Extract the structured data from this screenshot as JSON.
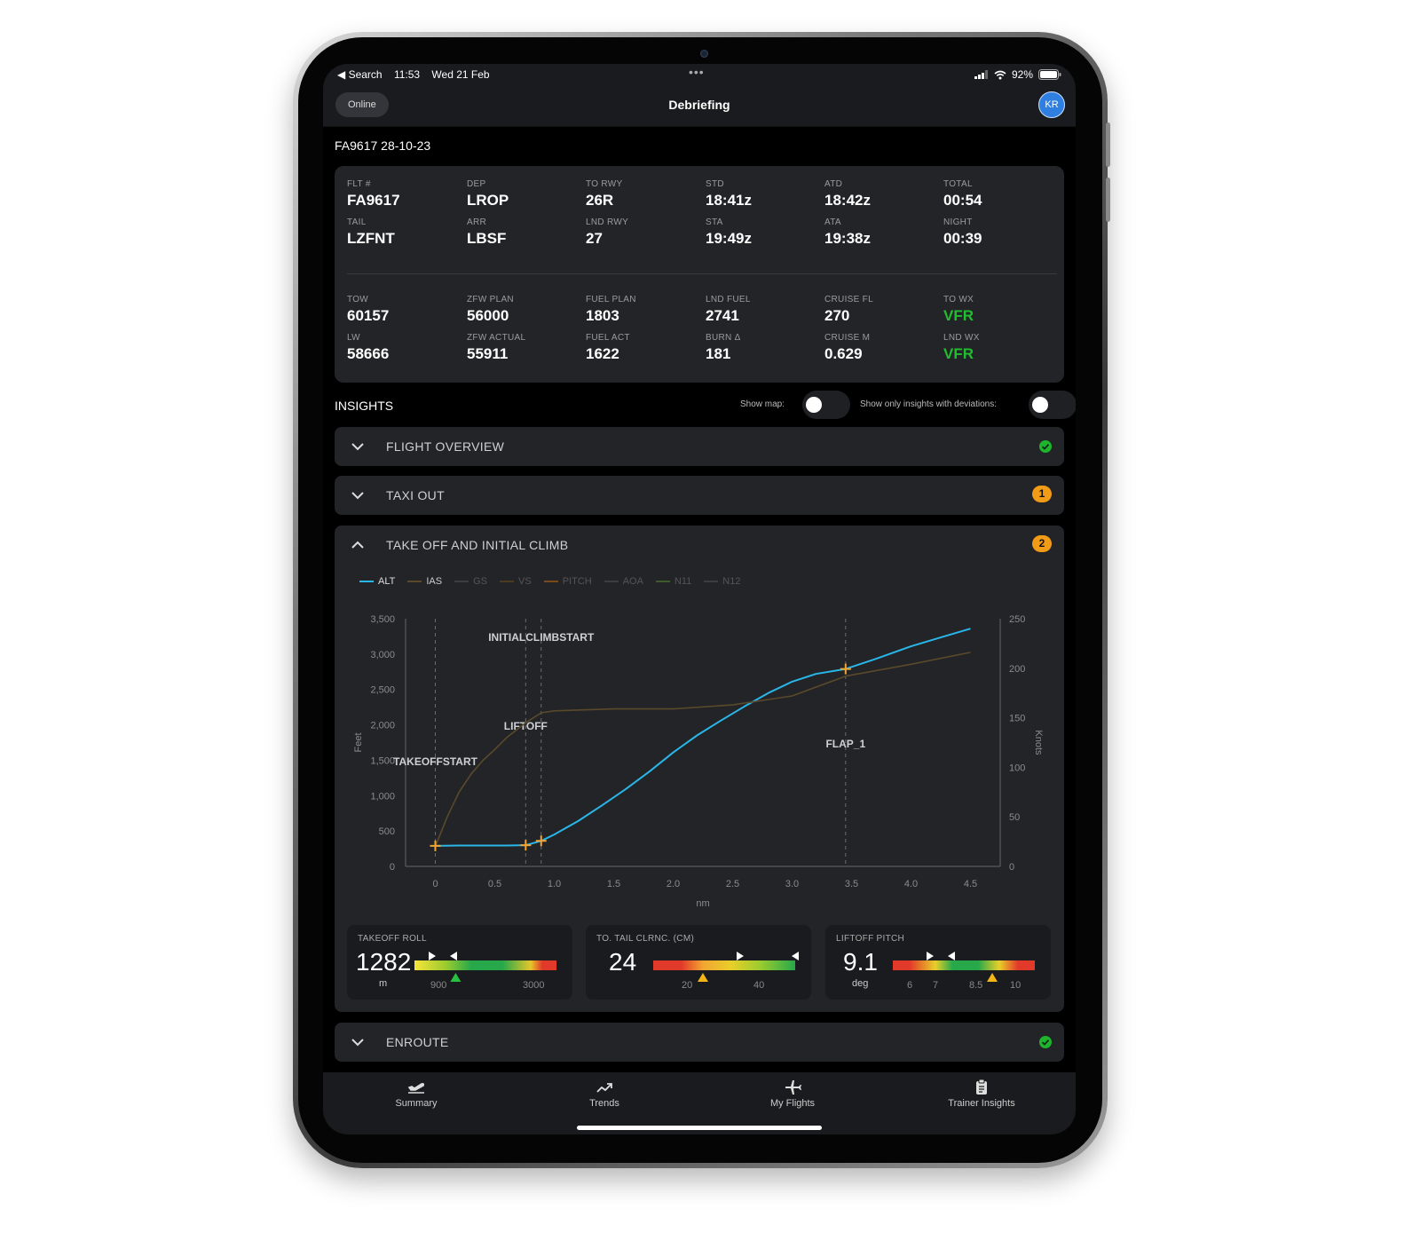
{
  "status_bar": {
    "back": "◀ Search",
    "time": "11:53",
    "date": "Wed 21 Feb",
    "battery": "92%"
  },
  "nav": {
    "online": "Online",
    "title": "Debriefing",
    "avatar": "KR"
  },
  "flight_header": "FA9617 28-10-23",
  "summary": {
    "row1": [
      {
        "label": "FLT #",
        "value": "FA9617"
      },
      {
        "label": "DEP",
        "value": "LROP"
      },
      {
        "label": "TO RWY",
        "value": "26R"
      },
      {
        "label": "STD",
        "value": "18:41z"
      },
      {
        "label": "ATD",
        "value": "18:42z"
      },
      {
        "label": "TOTAL",
        "value": "00:54"
      }
    ],
    "row2": [
      {
        "label": "TAIL",
        "value": "LZFNT"
      },
      {
        "label": "ARR",
        "value": "LBSF"
      },
      {
        "label": "LND RWY",
        "value": "27"
      },
      {
        "label": "STA",
        "value": "19:49z"
      },
      {
        "label": "ATA",
        "value": "19:38z"
      },
      {
        "label": "NIGHT",
        "value": "00:39"
      }
    ],
    "row3": [
      {
        "label": "TOW",
        "value": "60157"
      },
      {
        "label": "ZFW PLAN",
        "value": "56000"
      },
      {
        "label": "FUEL PLAN",
        "value": "1803"
      },
      {
        "label": "LND FUEL",
        "value": "2741"
      },
      {
        "label": "CRUISE FL",
        "value": "270"
      },
      {
        "label": "TO WX",
        "value": "VFR"
      }
    ],
    "row4": [
      {
        "label": "LW",
        "value": "58666"
      },
      {
        "label": "ZFW ACTUAL",
        "value": "55911"
      },
      {
        "label": "FUEL ACT",
        "value": "1622"
      },
      {
        "label": "BURN Δ",
        "value": "181"
      },
      {
        "label": "CRUISE M",
        "value": "0.629"
      },
      {
        "label": "LND WX",
        "value": "VFR"
      }
    ]
  },
  "insights": {
    "title": "INSIGHTS",
    "show_map": "Show map:",
    "show_deviations": "Show only insights with deviations:"
  },
  "sections": {
    "flight_overview": {
      "title": "FLIGHT OVERVIEW",
      "status": "ok"
    },
    "taxi_out": {
      "title": "TAXI OUT",
      "badge": "1"
    },
    "takeoff": {
      "title": "TAKE OFF AND INITIAL CLIMB",
      "badge": "2"
    },
    "enroute": {
      "title": "ENROUTE",
      "status": "ok"
    }
  },
  "chart_data": {
    "type": "line",
    "legend": [
      {
        "name": "ALT",
        "color": "#29b6e8",
        "active": true
      },
      {
        "name": "IAS",
        "color": "#5a4a2a",
        "active": true
      },
      {
        "name": "GS",
        "color": "#3a3d42",
        "active": false
      },
      {
        "name": "VS",
        "color": "#4a3c22",
        "active": false
      },
      {
        "name": "PITCH",
        "color": "#7a4a1a",
        "active": false
      },
      {
        "name": "AOA",
        "color": "#3a3d42",
        "active": false
      },
      {
        "name": "N11",
        "color": "#3e5a2a",
        "active": false
      },
      {
        "name": "N12",
        "color": "#3a3d42",
        "active": false
      }
    ],
    "xlabel": "nm",
    "ylabel_left": "Feet",
    "ylabel_right": "Knots",
    "x_ticks": [
      "0",
      "0.5",
      "1.0",
      "1.5",
      "2.0",
      "2.5",
      "3.0",
      "3.5",
      "4.0",
      "4.5"
    ],
    "y_left_ticks": [
      "0",
      "500",
      "1,000",
      "1,500",
      "2,000",
      "2,500",
      "3,000",
      "3,500"
    ],
    "y_right_ticks": [
      "0",
      "50",
      "100",
      "150",
      "200",
      "250"
    ],
    "xlim": [
      -0.25,
      4.75
    ],
    "ylim_left": [
      0,
      3500
    ],
    "ylim_right": [
      0,
      250
    ],
    "events": [
      {
        "name": "TAKEOFFSTART",
        "x": 0.0
      },
      {
        "name": "LIFTOFF",
        "x": 0.76
      },
      {
        "name": "INITIALCLIMBSTART",
        "x": 0.89
      },
      {
        "name": "FLAP_1",
        "x": 3.45
      }
    ],
    "series": [
      {
        "name": "ALT",
        "axis": "left",
        "color": "#29b6e8",
        "x": [
          0,
          0.2,
          0.4,
          0.6,
          0.76,
          0.89,
          1.0,
          1.2,
          1.4,
          1.6,
          1.8,
          2.0,
          2.2,
          2.4,
          2.6,
          2.8,
          3.0,
          3.2,
          3.45,
          3.7,
          4.0,
          4.3,
          4.5
        ],
        "values": [
          290,
          295,
          295,
          295,
          300,
          360,
          450,
          640,
          860,
          1090,
          1340,
          1610,
          1850,
          2060,
          2260,
          2450,
          2610,
          2720,
          2790,
          2930,
          3110,
          3260,
          3360
        ]
      },
      {
        "name": "IAS",
        "axis": "right",
        "color": "#5a4a2a",
        "x": [
          0,
          0.1,
          0.2,
          0.3,
          0.4,
          0.5,
          0.6,
          0.76,
          0.89,
          1.0,
          1.5,
          2.0,
          2.5,
          3.0,
          3.45,
          4.0,
          4.5
        ],
        "values": [
          20,
          50,
          75,
          93,
          107,
          118,
          130,
          145,
          155,
          157,
          159,
          159,
          163,
          172,
          192,
          204,
          216
        ]
      }
    ]
  },
  "gauges": {
    "takeoff_roll": {
      "label": "TAKEOFF ROLL",
      "value": "1282",
      "unit": "m",
      "value_color": "#3dbb4a",
      "ticks": [
        "900",
        "3000"
      ],
      "marker_fraction": 0.29
    },
    "tail_clearance": {
      "label": "TO. TAIL CLRNC. (CM)",
      "value": "24",
      "unit": "",
      "value_color": "#f2b619",
      "ticks": [
        "20",
        "40"
      ],
      "marker_fraction": 0.35
    },
    "liftoff_pitch": {
      "label": "LIFTOFF PITCH",
      "value": "9.1",
      "unit": "deg",
      "value_color": "#f2b619",
      "ticks": [
        "6",
        "7",
        "8.5",
        "10"
      ],
      "marker_fraction": 0.7
    }
  },
  "tabbar": {
    "summary": "Summary",
    "trends": "Trends",
    "my_flights": "My Flights",
    "trainer_insights": "Trainer Insights"
  }
}
